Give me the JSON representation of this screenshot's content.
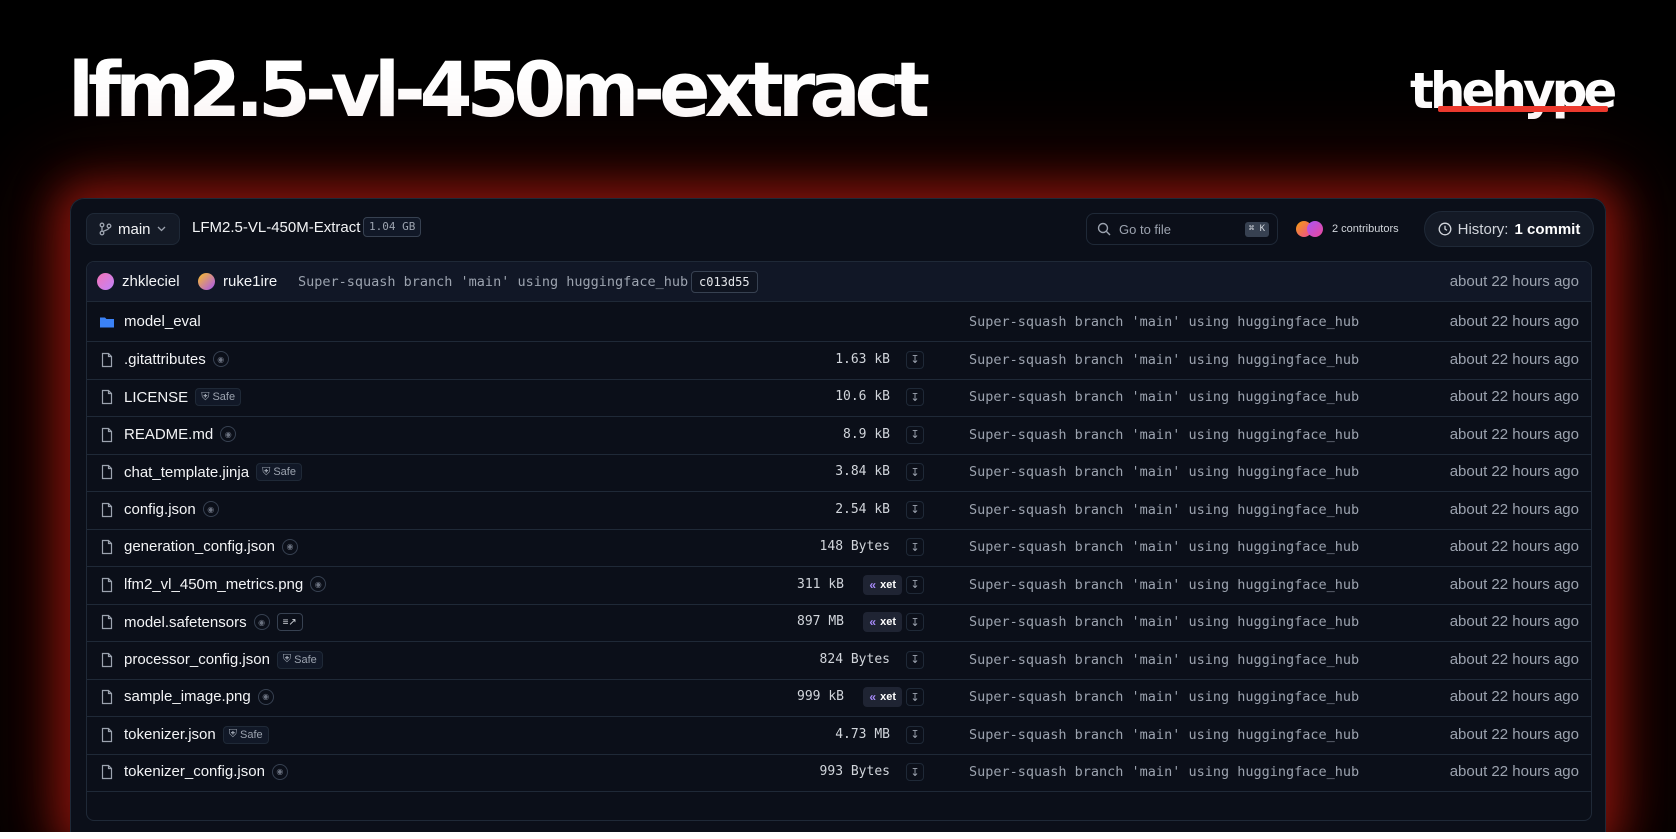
{
  "hero": {
    "title": "lfm2.5-vl-450m-extract"
  },
  "brand": {
    "logo_text": "thehype"
  },
  "toolbar": {
    "branch": "main",
    "repo_name": "LFM2.5-VL-450M-Extract",
    "repo_size": "1.04 GB",
    "search_placeholder": "Go to file",
    "search_shortcut": "⌘ K",
    "contributors": "2 contributors",
    "history_prefix": "History:",
    "history_count": "1 commit"
  },
  "commit": {
    "author1": "zhkleciel",
    "author2": "ruke1ire",
    "message": "Super-squash branch 'main' using huggingface_hub",
    "hash": "c013d55",
    "time": "about 22 hours ago"
  },
  "colors": {
    "accent_red": "#ef3b2f",
    "folder_blue": "#3b82f6",
    "xet_purple": "#a78bfa"
  },
  "files": [
    {
      "name": "model_eval",
      "type": "folder",
      "message": "Super-squash branch 'main' using huggingface_hub",
      "time": "about 22 hours ago"
    },
    {
      "name": ".gitattributes",
      "size": "1.63 kB",
      "message": "Super-squash branch 'main' using huggingface_hub",
      "time": "about 22 hours ago"
    },
    {
      "name": "LICENSE",
      "badge": "Safe",
      "size": "10.6 kB",
      "message": "Super-squash branch 'main' using huggingface_hub",
      "time": "about 22 hours ago"
    },
    {
      "name": "README.md",
      "size": "8.9 kB",
      "message": "Super-squash branch 'main' using huggingface_hub",
      "time": "about 22 hours ago"
    },
    {
      "name": "chat_template.jinja",
      "badge": "Safe",
      "size": "3.84 kB",
      "message": "Super-squash branch 'main' using huggingface_hub",
      "time": "about 22 hours ago"
    },
    {
      "name": "config.json",
      "size": "2.54 kB",
      "message": "Super-squash branch 'main' using huggingface_hub",
      "time": "about 22 hours ago"
    },
    {
      "name": "generation_config.json",
      "size": "148 Bytes",
      "message": "Super-squash branch 'main' using huggingface_hub",
      "time": "about 22 hours ago"
    },
    {
      "name": "lfm2_vl_450m_metrics.png",
      "size": "311 kB",
      "storage": "xet",
      "message": "Super-squash branch 'main' using huggingface_hub",
      "time": "about 22 hours ago"
    },
    {
      "name": "model.safetensors",
      "size": "897 MB",
      "storage": "xet",
      "message": "Super-squash branch 'main' using huggingface_hub",
      "time": "about 22 hours ago"
    },
    {
      "name": "processor_config.json",
      "badge": "Safe",
      "size": "824 Bytes",
      "message": "Super-squash branch 'main' using huggingface_hub",
      "time": "about 22 hours ago"
    },
    {
      "name": "sample_image.png",
      "size": "999 kB",
      "storage": "xet",
      "message": "Super-squash branch 'main' using huggingface_hub",
      "time": "about 22 hours ago"
    },
    {
      "name": "tokenizer.json",
      "badge": "Safe",
      "size": "4.73 MB",
      "message": "Super-squash branch 'main' using huggingface_hub",
      "time": "about 22 hours ago"
    },
    {
      "name": "tokenizer_config.json",
      "size": "993 Bytes",
      "message": "Super-squash branch 'main' using huggingface_hub",
      "time": "about 22 hours ago"
    }
  ]
}
